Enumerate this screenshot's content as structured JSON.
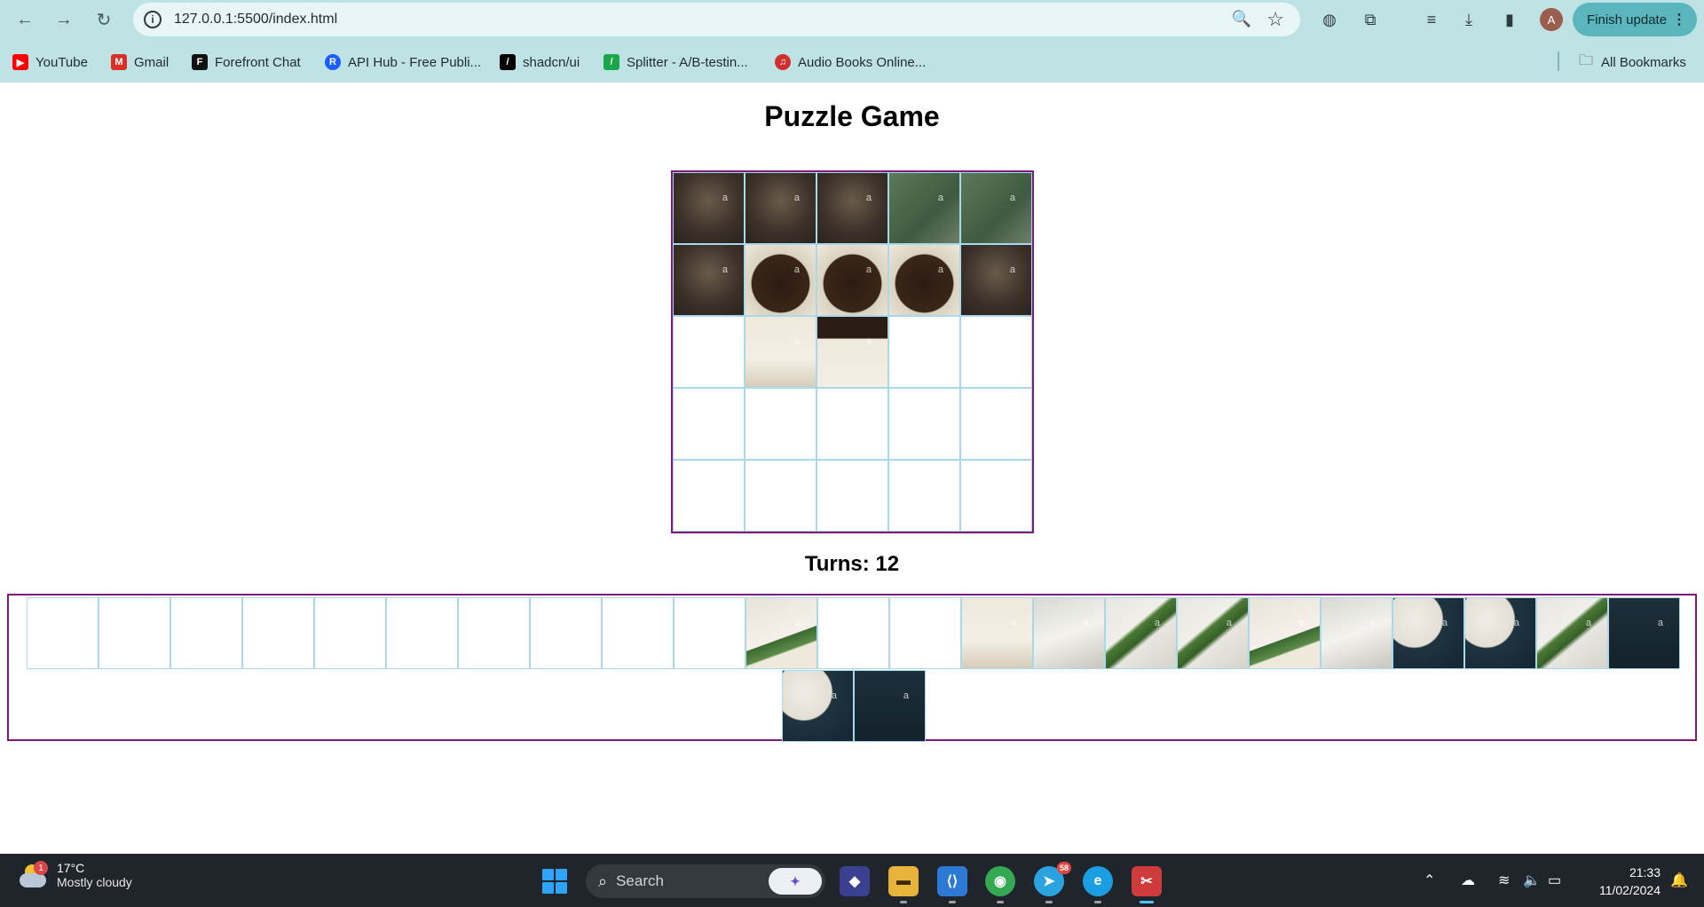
{
  "browser": {
    "url": "127.0.0.1:5500/index.html",
    "finish_update_label": "Finish update",
    "profile_initial": "A",
    "bookmarks": [
      {
        "label": "YouTube",
        "icon": "youtube-icon",
        "color": "#ff0000"
      },
      {
        "label": "Gmail",
        "icon": "gmail-icon",
        "color": "#d93025"
      },
      {
        "label": "Forefront Chat",
        "icon": "forefront-icon",
        "color": "#111111"
      },
      {
        "label": "API Hub - Free Publi...",
        "icon": "apihub-icon",
        "color": "#1a5cff"
      },
      {
        "label": "shadcn/ui",
        "icon": "shadcn-icon",
        "color": "#000000"
      },
      {
        "label": "Splitter - A/B-testin...",
        "icon": "splitter-icon",
        "color": "#1aa64a"
      },
      {
        "label": "Audio Books Online...",
        "icon": "audiobooks-icon",
        "color": "#d32f2f"
      }
    ],
    "all_bookmarks_label": "All Bookmarks"
  },
  "page": {
    "title": "Puzzle Game",
    "turns_label": "Turns: 12",
    "accent_border": "#7b1a7b",
    "tile_border": "#a8d8ea",
    "board": [
      [
        "dark",
        "dark",
        "dark",
        "green",
        "green"
      ],
      [
        "dark",
        "coffee",
        "coffee",
        "coffee",
        "dark"
      ],
      [
        "empty",
        "cup",
        "cup-red",
        "empty",
        "empty"
      ],
      [
        "empty",
        "empty",
        "empty",
        "empty",
        "empty"
      ],
      [
        "empty",
        "empty",
        "empty",
        "empty",
        "empty"
      ]
    ],
    "tray_row1": [
      "empty",
      "empty",
      "empty",
      "empty",
      "empty",
      "empty",
      "empty",
      "empty",
      "empty",
      "empty",
      "leaf",
      "empty",
      "empty",
      "cup",
      "plate",
      "herb",
      "herb",
      "leaf",
      "plate",
      "navy",
      "navy",
      "herb",
      "deep"
    ],
    "tray_row2": [
      "navy",
      "deep"
    ],
    "watermark": "a"
  },
  "taskbar": {
    "weather_temp": "17°C",
    "weather_desc": "Mostly cloudy",
    "weather_badge": "1",
    "search_placeholder": "Search",
    "time": "21:33",
    "date": "11/02/2024",
    "telegram_badge": "58"
  }
}
